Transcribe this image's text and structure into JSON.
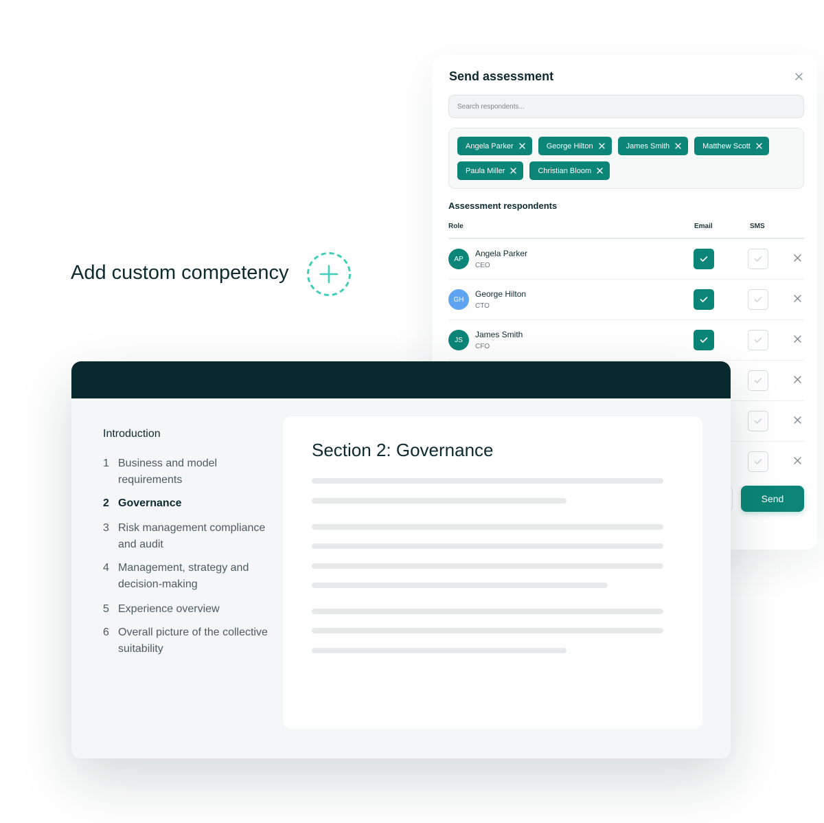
{
  "send_panel": {
    "title": "Send assessment",
    "search_placeholder": "Search respondents...",
    "chips": [
      {
        "label": "Angela Parker"
      },
      {
        "label": "George Hilton"
      },
      {
        "label": "James Smith"
      },
      {
        "label": "Matthew Scott"
      },
      {
        "label": "Paula Miller"
      },
      {
        "label": "Christian Bloom"
      }
    ],
    "respondents_title": "Assessment respondents",
    "columns": {
      "role": "Role",
      "email": "Email",
      "sms": "SMS"
    },
    "rows": [
      {
        "initials": "AP",
        "name": "Angela Parker",
        "role": "CEO",
        "email": true,
        "sms": false,
        "avatar_color": "#0a8577"
      },
      {
        "initials": "GH",
        "name": "George Hilton",
        "role": "CTO",
        "email": true,
        "sms": false,
        "avatar_color": "#5ea4f0"
      },
      {
        "initials": "JS",
        "name": "James Smith",
        "role": "CFO",
        "email": true,
        "sms": false,
        "avatar_color": "#0a8577"
      }
    ],
    "send_label": "Send"
  },
  "competency": {
    "label": "Add custom competency"
  },
  "assessment": {
    "intro_label": "Introduction",
    "sections": [
      {
        "num": "1",
        "title": "Business and model requirements",
        "active": false
      },
      {
        "num": "2",
        "title": "Governance",
        "active": true
      },
      {
        "num": "3",
        "title": "Risk management compliance and audit",
        "active": false
      },
      {
        "num": "4",
        "title": "Management, strategy and decision-making",
        "active": false
      },
      {
        "num": "5",
        "title": "Experience overview",
        "active": false
      },
      {
        "num": "6",
        "title": "Overall picture of the collective suitability",
        "active": false
      }
    ],
    "section_heading": "Section 2: Governance"
  },
  "colors": {
    "brand": "#0a8577",
    "dark_header": "#08292e",
    "accent_dashed": "#3fcdb8",
    "avatar_blue": "#5ea4f0"
  }
}
